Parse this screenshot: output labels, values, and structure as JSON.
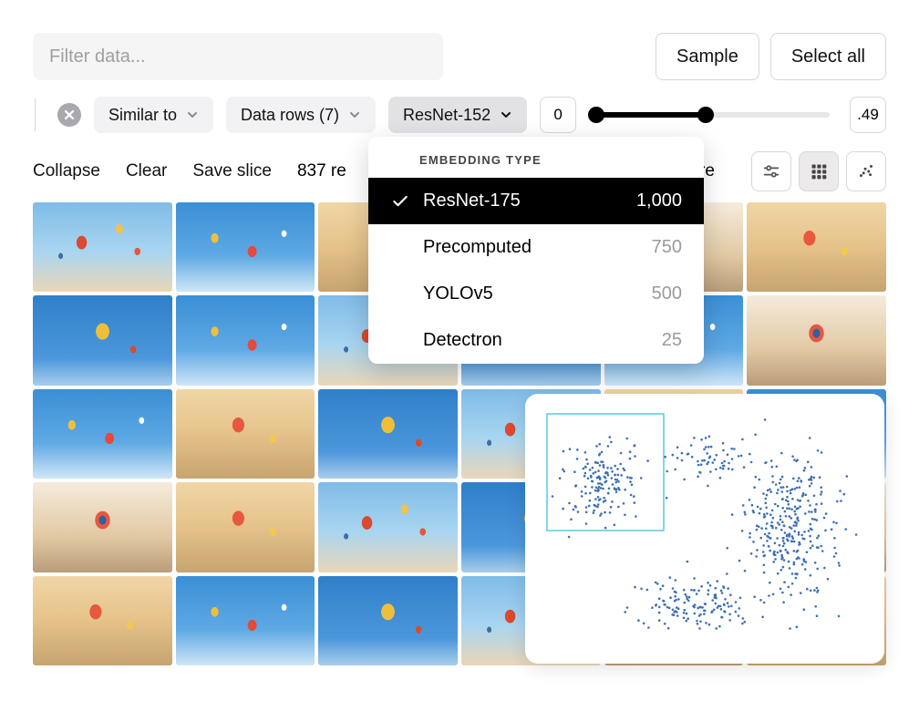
{
  "top": {
    "filter_placeholder": "Filter data...",
    "sample_label": "Sample",
    "select_all_label": "Select all"
  },
  "filters": {
    "similar_to_label": "Similar to",
    "data_rows_label": "Data rows (7)",
    "embedding_button_label": "ResNet-152",
    "range_min": "0",
    "range_max": ".49"
  },
  "actions": {
    "collapse": "Collapse",
    "clear": "Clear",
    "save_slice": "Save slice",
    "results_count": "837 re",
    "ore": "ore"
  },
  "dropdown": {
    "title": "EMBEDDING TYPE",
    "items": [
      {
        "label": "ResNet-175",
        "count": "1,000",
        "selected": true
      },
      {
        "label": "Precomputed",
        "count": "750",
        "selected": false
      },
      {
        "label": "YOLOv5",
        "count": "500",
        "selected": false
      },
      {
        "label": "Detectron",
        "count": "25",
        "selected": false
      }
    ]
  },
  "scatter": {
    "selection_box": {
      "x": 24,
      "y": 22,
      "w": 128,
      "h": 128
    }
  }
}
